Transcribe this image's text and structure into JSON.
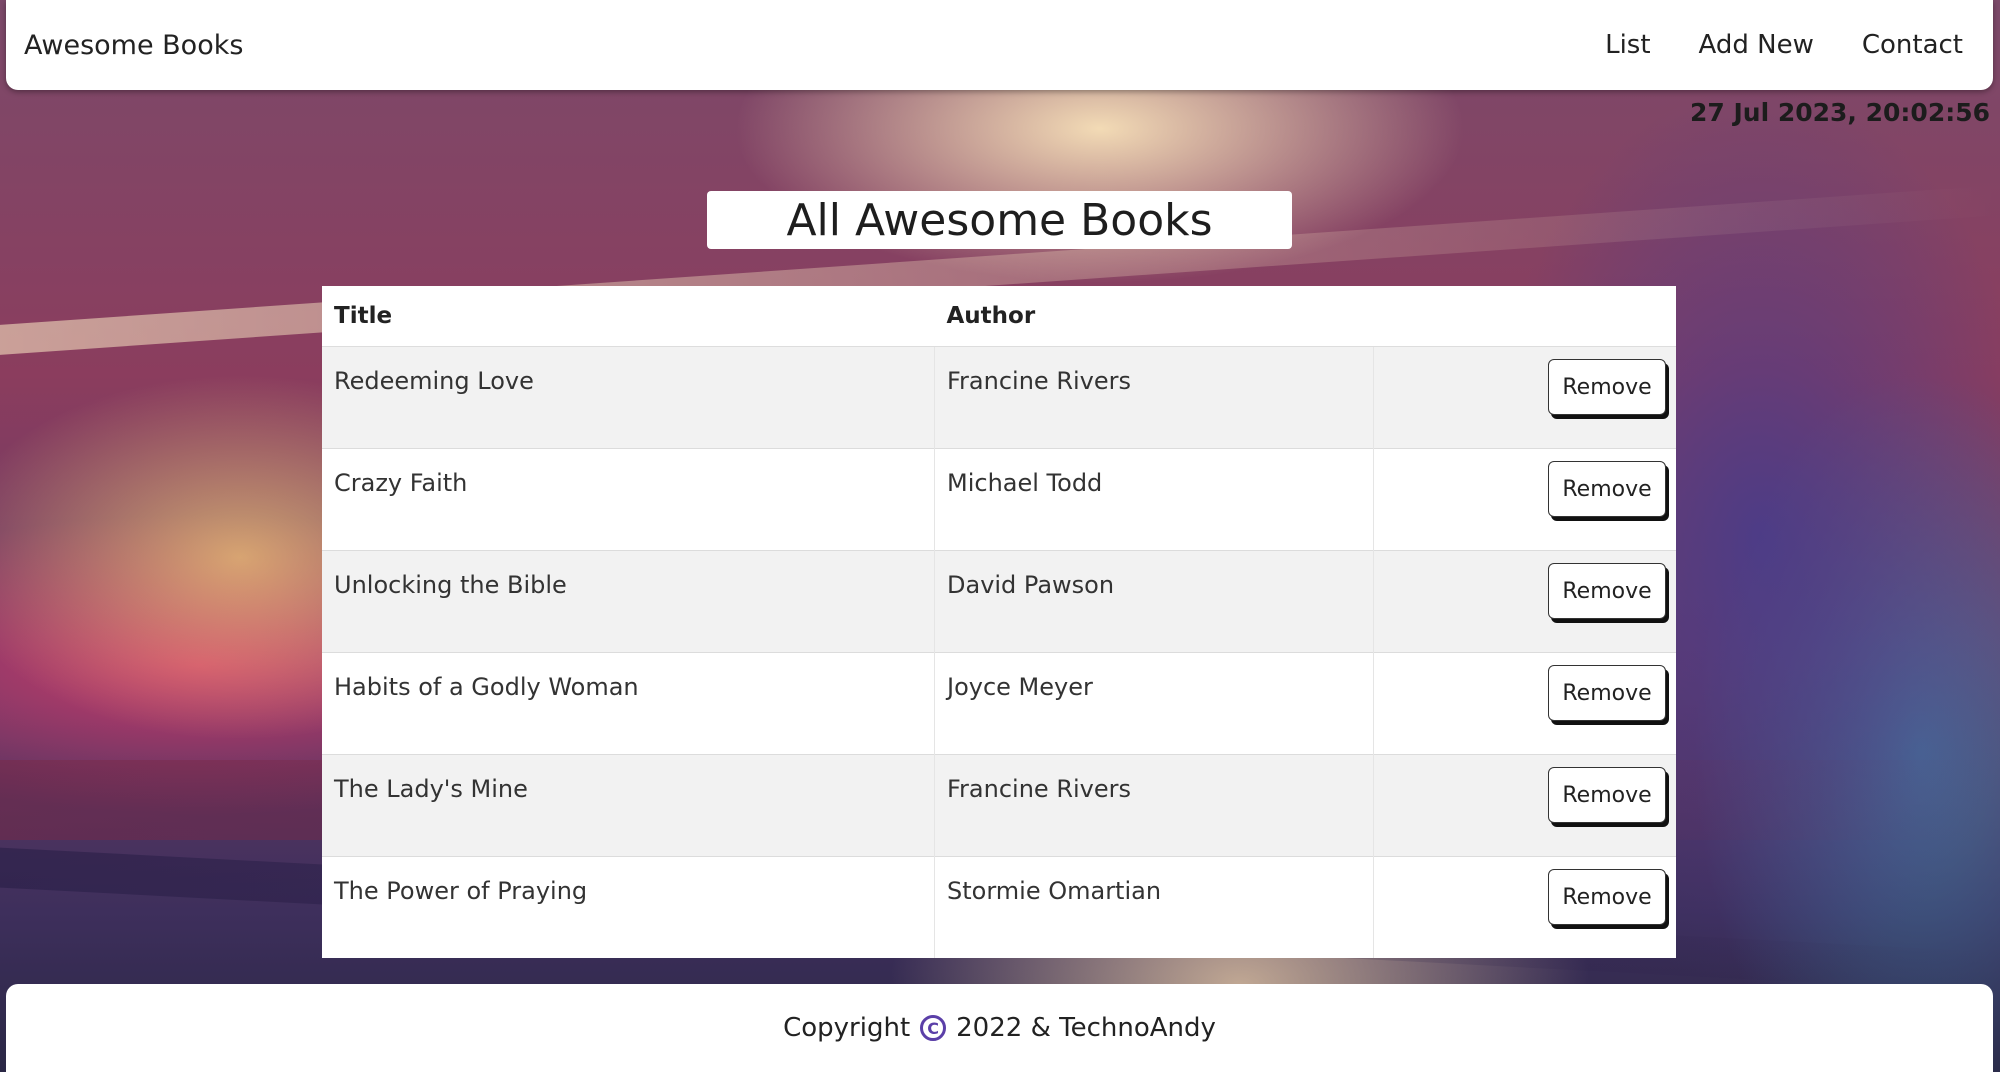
{
  "brand": "Awesome Books",
  "nav": {
    "list": "List",
    "add_new": "Add New",
    "contact": "Contact"
  },
  "datetime": "27 Jul 2023, 20:02:56",
  "page_title": "All Awesome Books",
  "table": {
    "headers": {
      "title": "Title",
      "author": "Author"
    },
    "remove_label": "Remove",
    "rows": [
      {
        "title": "Redeeming Love",
        "author": "Francine Rivers"
      },
      {
        "title": "Crazy Faith",
        "author": "Michael Todd"
      },
      {
        "title": "Unlocking the Bible",
        "author": "David Pawson"
      },
      {
        "title": "Habits of a Godly Woman",
        "author": "Joyce Meyer"
      },
      {
        "title": "The Lady's Mine",
        "author": "Francine Rivers"
      },
      {
        "title": "The Power of Praying",
        "author": "Stormie Omartian"
      }
    ]
  },
  "footer": {
    "copyright_label": "Copyright",
    "copyright_symbol": "C",
    "year_owner": "2022 & TechnoAndy"
  },
  "colors": {
    "copyright_icon": "#5b3fa8",
    "row_odd": "#f2f2f2",
    "row_even": "#ffffff"
  }
}
